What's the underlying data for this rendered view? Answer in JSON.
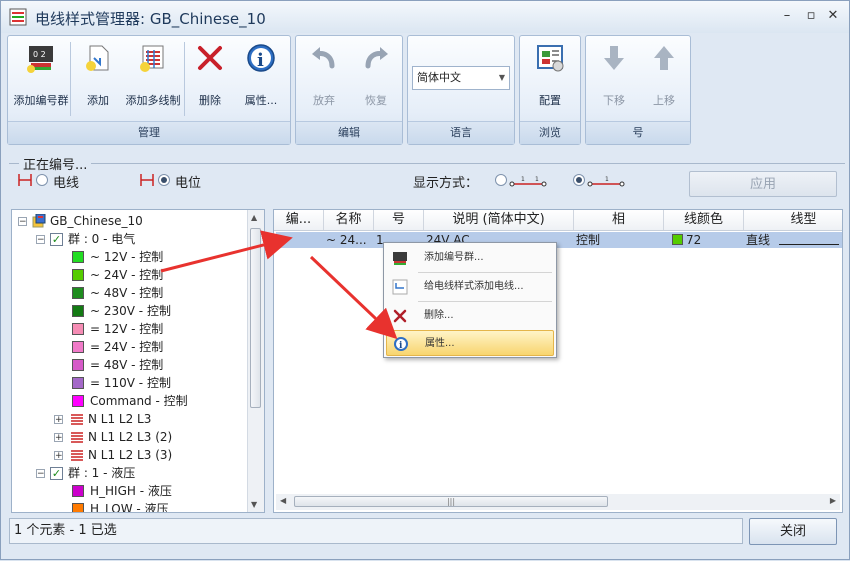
{
  "window": {
    "title": "电线样式管理器: GB_Chinese_10",
    "minimize": "–",
    "maximize": "▫",
    "close": "✕"
  },
  "ribbon": {
    "groups": [
      {
        "caption": "管理",
        "buttons": [
          "添加编号群",
          "添加",
          "添加多线制",
          "删除",
          "属性..."
        ]
      },
      {
        "caption": "编辑",
        "buttons": [
          "放弃",
          "恢复"
        ]
      },
      {
        "caption": "语言",
        "combo_value": "简体中文"
      },
      {
        "caption": "浏览",
        "buttons": [
          "配置"
        ]
      },
      {
        "caption": "号",
        "buttons": [
          "下移",
          "上移"
        ]
      }
    ]
  },
  "numbering": {
    "legend": "正在编号...",
    "option_wire": "电线",
    "option_potential": "电位",
    "selected": "电位",
    "display_label": "显示方式：",
    "apply_button": "应用"
  },
  "tree": {
    "items": [
      {
        "label": "GB_Chinese_10",
        "level": 0,
        "kind": "root",
        "expander": "−"
      },
      {
        "label": "群 : 0 - 电气",
        "level": 1,
        "kind": "group",
        "expander": "−",
        "checked": true
      },
      {
        "label": "~  12V - 控制",
        "level": 2,
        "kind": "wire",
        "color": "#22dd22"
      },
      {
        "label": "~  24V - 控制",
        "level": 2,
        "kind": "wire",
        "color": "#55cc00"
      },
      {
        "label": "~  48V  - 控制",
        "level": 2,
        "kind": "wire",
        "color": "#1e8c1e"
      },
      {
        "label": "~ 230V - 控制",
        "level": 2,
        "kind": "wire",
        "color": "#137a13"
      },
      {
        "label": "=   12V - 控制",
        "level": 2,
        "kind": "wire",
        "color": "#f58cb4"
      },
      {
        "label": "=   24V - 控制",
        "level": 2,
        "kind": "wire",
        "color": "#f07ac8"
      },
      {
        "label": "=   48V - 控制",
        "level": 2,
        "kind": "wire",
        "color": "#d65ac8"
      },
      {
        "label": "= 110V - 控制",
        "level": 2,
        "kind": "wire",
        "color": "#a468c8"
      },
      {
        "label": "Command - 控制",
        "level": 2,
        "kind": "wire",
        "color": "#ff00ff"
      },
      {
        "label": "N L1 L2 L3",
        "level": 2,
        "kind": "multi",
        "expander": "+"
      },
      {
        "label": "N L1 L2 L3 (2)",
        "level": 2,
        "kind": "multi",
        "expander": "+"
      },
      {
        "label": "N L1 L2 L3 (3)",
        "level": 2,
        "kind": "multi",
        "expander": "+"
      },
      {
        "label": "群 : 1 - 液压",
        "level": 1,
        "kind": "group",
        "expander": "−",
        "checked": true
      },
      {
        "label": "H_HIGH - 液压",
        "level": 2,
        "kind": "wire",
        "color": "#cc00cc"
      },
      {
        "label": "H_LOW - 液压",
        "level": 2,
        "kind": "wire",
        "color": "#ff7a00"
      }
    ]
  },
  "grid": {
    "columns": [
      "编...",
      "名称",
      "号",
      "说明 (简体中文)",
      "相",
      "线颜色",
      "线型"
    ],
    "rows": [
      {
        "num": "",
        "name": "~ 24...",
        "no": "1",
        "desc": "24V AC",
        "phase": "控制",
        "color_swatch": "#55cc00",
        "color_code": "72",
        "line_type": "直线"
      }
    ]
  },
  "context_menu": {
    "items": [
      "添加编号群...",
      "给电线样式添加电线...",
      "删除...",
      "属性..."
    ],
    "highlighted": "属性..."
  },
  "status": {
    "text": "1 个元素 - 1 已选",
    "close_button": "关闭"
  }
}
